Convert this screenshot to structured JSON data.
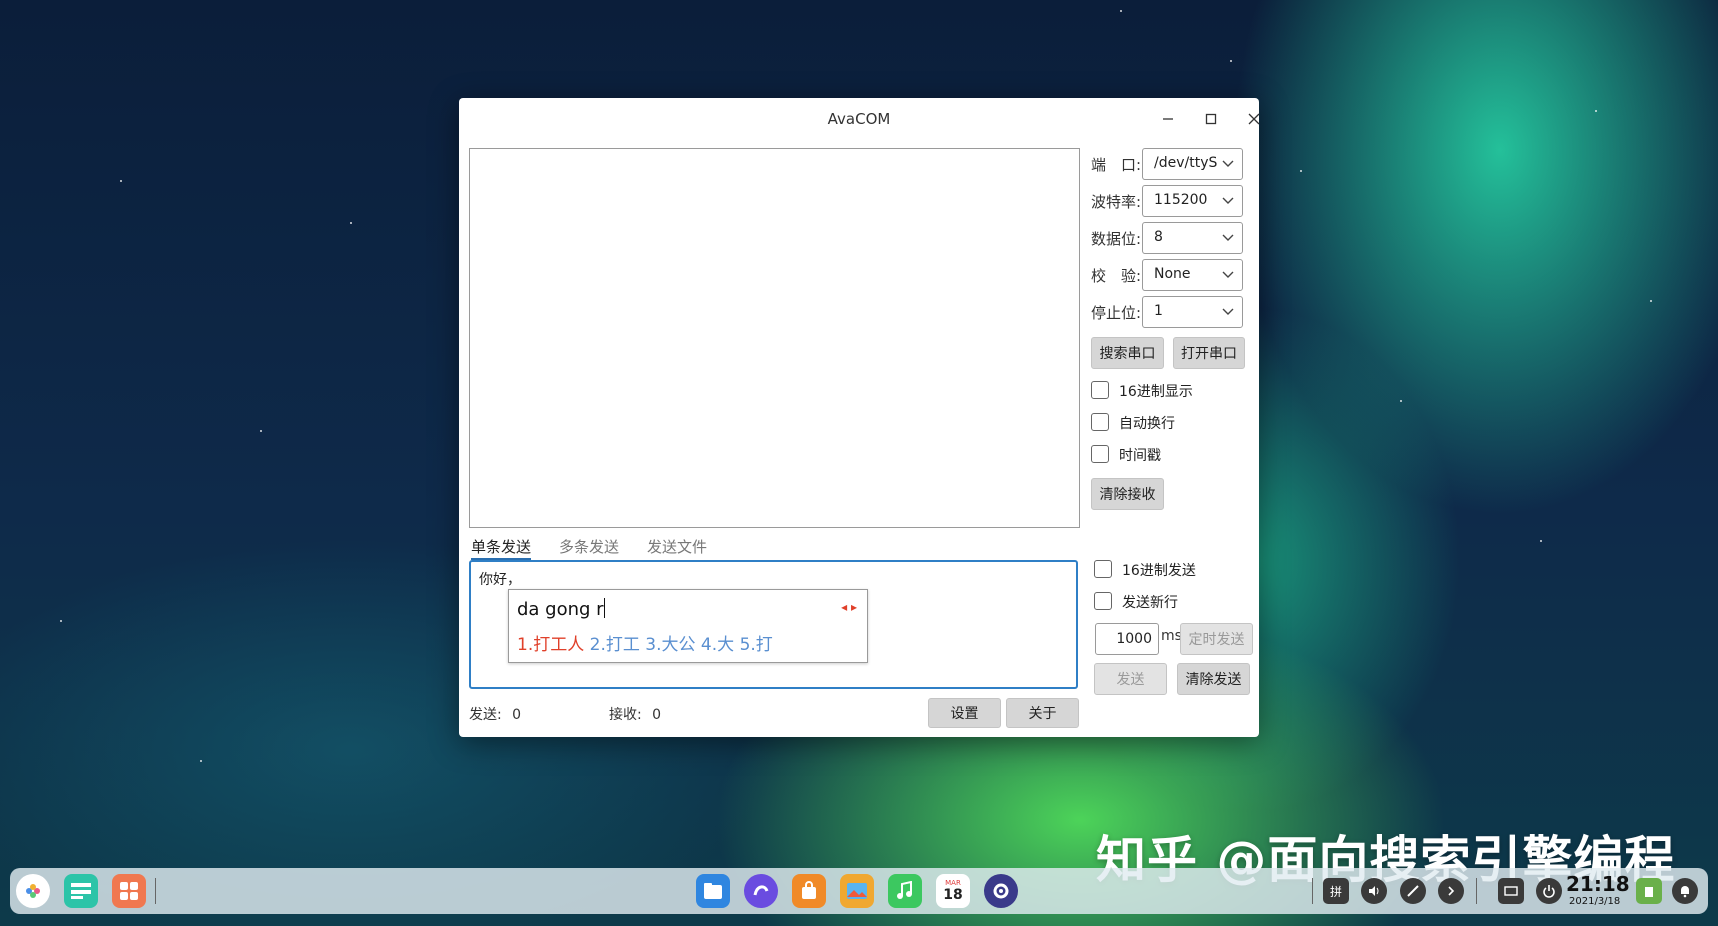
{
  "window": {
    "title": "AvaCOM"
  },
  "serial": {
    "port_label": "端　口:",
    "port_value": "/dev/ttyS",
    "baud_label": "波特率:",
    "baud_value": "115200",
    "databits_label": "数据位:",
    "databits_value": "8",
    "parity_label": "校　验:",
    "parity_value": "None",
    "stopbits_label": "停止位:",
    "stopbits_value": "1",
    "search_button": "搜索串口",
    "open_button": "打开串口"
  },
  "receive_options": {
    "hex_display": "16进制显示",
    "auto_wrap": "自动换行",
    "timestamp": "时间戳",
    "clear_receive": "清除接收"
  },
  "tabs": [
    "单条发送",
    "多条发送",
    "发送文件"
  ],
  "send": {
    "text": "你好，",
    "hex_send": "16进制发送",
    "send_newline": "发送新行",
    "interval_value": "1000",
    "interval_unit": "ms",
    "timed_send": "定时发送",
    "send_button": "发送",
    "clear_send": "清除发送"
  },
  "ime": {
    "input": "da gong r",
    "candidates": [
      "1.打工人",
      "2.打工",
      "3.大公",
      "4.大",
      "5.打"
    ]
  },
  "status": {
    "sent_label": "发送:",
    "sent_value": "0",
    "recv_label": "接收:",
    "recv_value": "0",
    "settings_button": "设置",
    "about_button": "关于"
  },
  "watermark": "知乎 @面向搜索引擎编程",
  "taskbar": {
    "calendar_month": "MAR",
    "calendar_day": "18",
    "ime_indicator": "拼",
    "time": "21:18",
    "date": "2021/3/18"
  }
}
